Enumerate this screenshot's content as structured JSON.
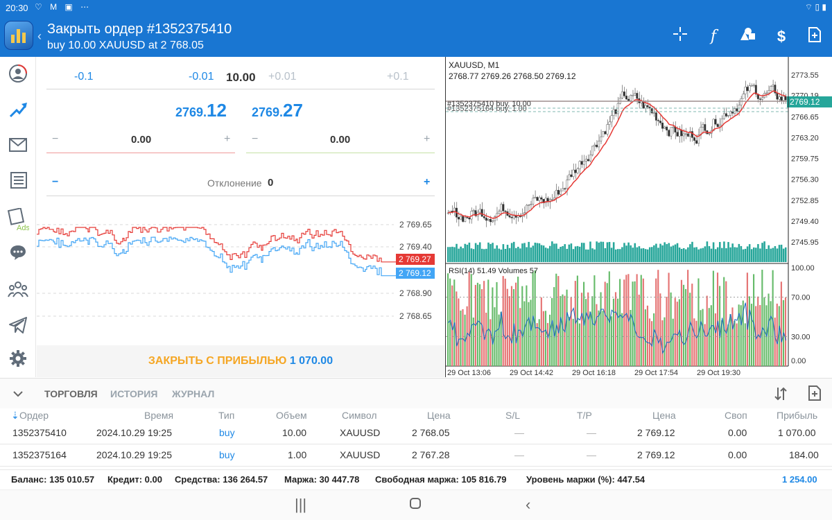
{
  "status": {
    "time": "20:30",
    "icons": "♡ M ▣ ⋯",
    "right_icons": "⌔ ▯ ▮"
  },
  "header": {
    "title": "Закрыть ордер #1352375410",
    "subtitle": "buy 10.00 XAUUSD at 2 768.05"
  },
  "toolbar": {
    "crosshair": "crosshair-icon",
    "indicators": "f",
    "objects": "objects-icon",
    "trade": "$",
    "add": "+"
  },
  "volume": {
    "minus_big": "-0.1",
    "minus_small": "-0.01",
    "value": "10.00",
    "plus_small": "+0.01",
    "plus_big": "+0.1"
  },
  "prices": {
    "bid_small": "2769.",
    "bid_big": "12",
    "ask_small": "2769.",
    "ask_big": "27"
  },
  "sltp": {
    "sl_minus": "−",
    "sl_value": "0.00",
    "sl_plus": "+",
    "tp_minus": "−",
    "tp_value": "0.00",
    "tp_plus": "+"
  },
  "deviation": {
    "minus": "−",
    "label": "Отклонение",
    "value": "0",
    "plus": "+"
  },
  "tick_chart": {
    "y_labels": [
      "2 769.65",
      "2 769.40",
      "2 768.90",
      "2 768.65"
    ],
    "ask_badge": "2 769.27",
    "bid_badge": "2 769.12",
    "ask_color": "#e53935",
    "bid_color": "#42a5f5"
  },
  "close": {
    "label": "ЗАКРЫТЬ С ПРИБЫЛЬЮ",
    "value": "1 070.00"
  },
  "chart_data": {
    "type": "line",
    "title": "XAUUSD, M1",
    "ohlc": "2768.77 2769.26 2768.50 2769.12",
    "y_ticks": [
      "2773.55",
      "2770.19",
      "2766.65",
      "2763.20",
      "2759.75",
      "2756.30",
      "2752.85",
      "2749.40",
      "2745.95"
    ],
    "price_badge": "2769.12",
    "order_line_1": "#1352375410 buy, 10.00",
    "order_line_2": "#1352375164 buy, 1.00",
    "rsi_label": "RSI(14) 51.49 Volumes 57",
    "rsi_ticks": [
      "100.00",
      "70.00",
      "30.00",
      "0.00"
    ],
    "x_ticks": [
      "29 Oct 13:06",
      "29 Oct 14:42",
      "29 Oct 16:18",
      "29 Oct 17:54",
      "29 Oct 19:30"
    ],
    "ylim": [
      2745.95,
      2773.55
    ],
    "colors": {
      "up": "#26a69a",
      "down": "#ef5350",
      "ma": "#e53935",
      "badge": "#26a69a"
    }
  },
  "tabs": [
    "ТОРГОВЛЯ",
    "ИСТОРИЯ",
    "ЖУРНАЛ"
  ],
  "table": {
    "headers": [
      "Ордер",
      "Время",
      "Тип",
      "Объем",
      "Символ",
      "Цена",
      "S/L",
      "T/P",
      "Цена",
      "Своп",
      "Прибыль"
    ],
    "rows": [
      [
        "1352375410",
        "2024.10.29 19:25",
        "buy",
        "10.00",
        "XAUUSD",
        "2 768.05",
        "—",
        "—",
        "2 769.12",
        "0.00",
        "1 070.00"
      ],
      [
        "1352375164",
        "2024.10.29 19:25",
        "buy",
        "1.00",
        "XAUUSD",
        "2 767.28",
        "—",
        "—",
        "2 769.12",
        "0.00",
        "184.00"
      ]
    ]
  },
  "summary": {
    "balance": "Баланс: 135 010.57",
    "credit": "Кредит: 0.00",
    "equity": "Средства: 136 264.57",
    "margin": "Маржа: 30 447.78",
    "free_margin": "Свободная маржа: 105 816.79",
    "margin_level": "Уровень маржи (%): 447.54",
    "total": "1 254.00"
  }
}
